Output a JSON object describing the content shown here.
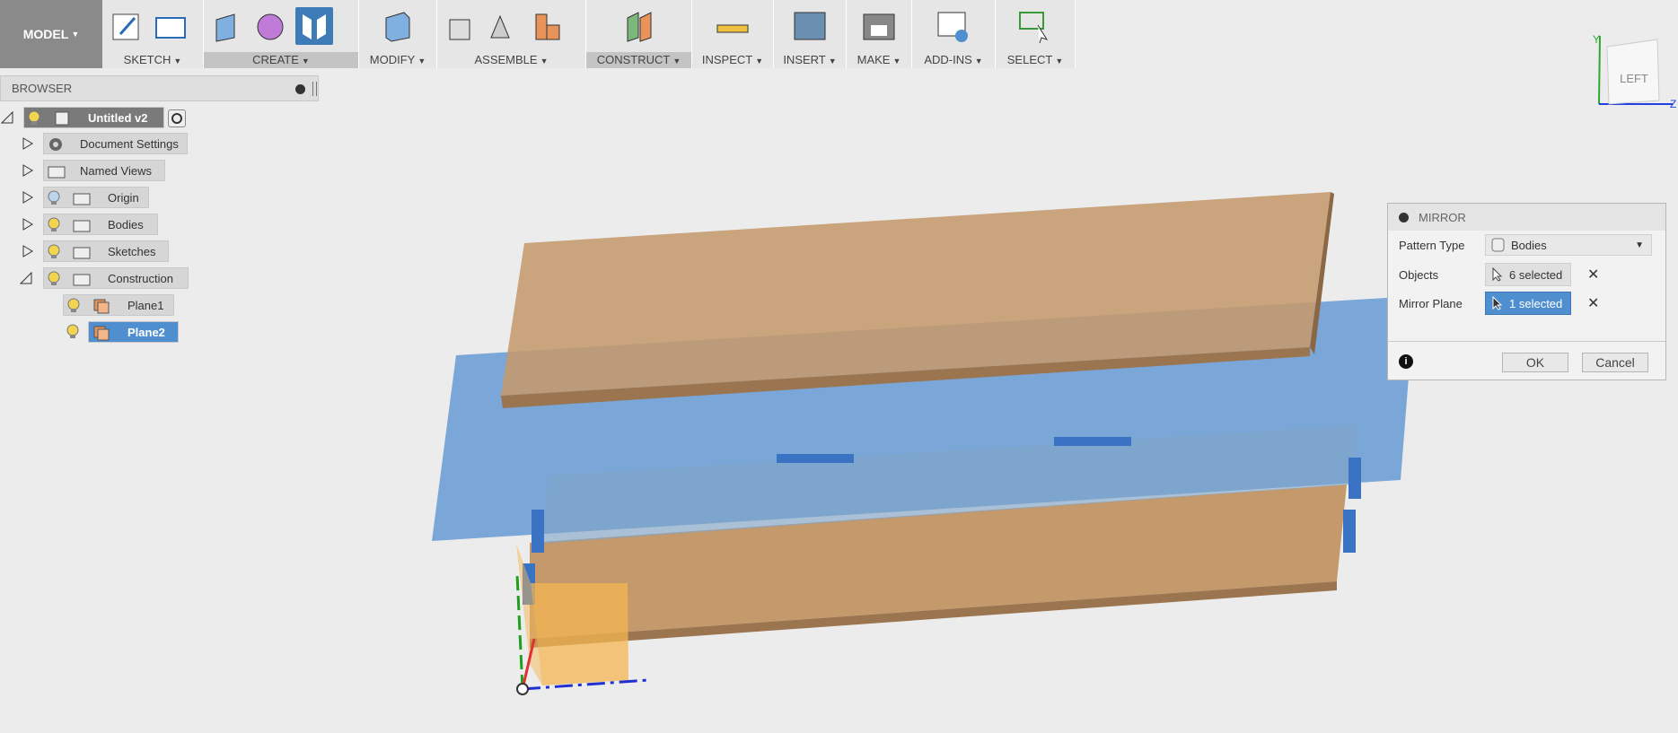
{
  "toolbar": {
    "model_label": "MODEL",
    "groups": [
      {
        "label": "SKETCH"
      },
      {
        "label": "CREATE"
      },
      {
        "label": "MODIFY"
      },
      {
        "label": "ASSEMBLE"
      },
      {
        "label": "CONSTRUCT"
      },
      {
        "label": "INSPECT"
      },
      {
        "label": "INSERT"
      },
      {
        "label": "MAKE"
      },
      {
        "label": "ADD-INS"
      },
      {
        "label": "SELECT"
      }
    ],
    "caret": "▼"
  },
  "browser": {
    "title": "BROWSER",
    "root": "Untitled v2",
    "items": [
      {
        "label": "Document Settings"
      },
      {
        "label": "Named Views"
      },
      {
        "label": "Origin"
      },
      {
        "label": "Bodies"
      },
      {
        "label": "Sketches"
      },
      {
        "label": "Construction"
      },
      {
        "label": "Plane1"
      },
      {
        "label": "Plane2"
      }
    ]
  },
  "mirror": {
    "title": "MIRROR",
    "pattern_type_label": "Pattern Type",
    "pattern_type_value": "Bodies",
    "objects_label": "Objects",
    "objects_value": "6 selected",
    "mirror_plane_label": "Mirror Plane",
    "mirror_plane_value": "1 selected",
    "ok_label": "OK",
    "cancel_label": "Cancel",
    "clear_glyph": "✕",
    "info_glyph": "i"
  },
  "viewcube": {
    "face_label": "LEFT",
    "axis_y": "Y",
    "axis_z": "Z"
  },
  "colors": {
    "accent": "#3e7cb8",
    "wood": "#c49a6c",
    "plane": "#4a8ad0"
  }
}
